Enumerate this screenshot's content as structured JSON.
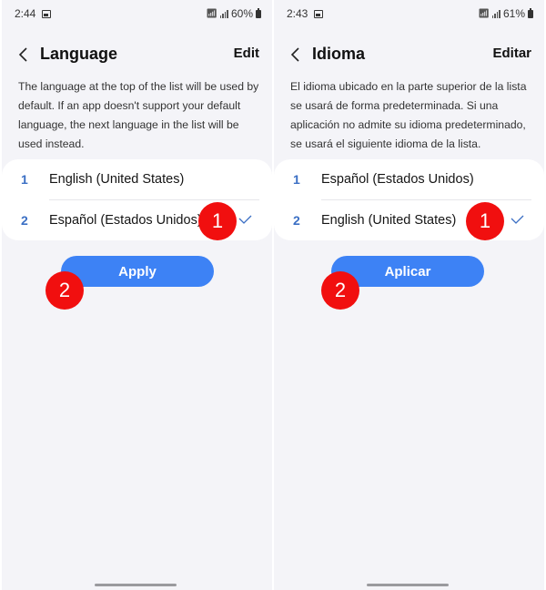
{
  "screens": [
    {
      "status": {
        "time": "2:44",
        "battery": "60%"
      },
      "header": {
        "back_icon": "chevron-left-icon",
        "title": "Language",
        "edit_label": "Edit"
      },
      "description": "The language at the top of the list will be used by default. If an app doesn't support your default language, the next language in the list will be used instead.",
      "languages": [
        {
          "index": "1",
          "name": "English (United States)",
          "selected": false
        },
        {
          "index": "2",
          "name": "Español (Estados Unidos)",
          "selected": true
        }
      ],
      "apply_label": "Apply",
      "annotations": [
        "1",
        "2"
      ]
    },
    {
      "status": {
        "time": "2:43",
        "battery": "61%"
      },
      "header": {
        "back_icon": "chevron-left-icon",
        "title": "Idioma",
        "edit_label": "Editar"
      },
      "description": "El idioma ubicado en la parte superior de la lista se usará de forma predeterminada. Si una aplicación no admite su idioma predeterminado, se usará el siguiente idioma de la lista.",
      "languages": [
        {
          "index": "1",
          "name": "Español (Estados Unidos)",
          "selected": false
        },
        {
          "index": "2",
          "name": "English (United States)",
          "selected": true
        }
      ],
      "apply_label": "Aplicar",
      "annotations": [
        "1",
        "2"
      ]
    }
  ],
  "colors": {
    "accent": "#3d82f5",
    "index_number": "#3b6fc4",
    "annotation_badge": "#f10f0f",
    "background": "#f4f4f8"
  }
}
